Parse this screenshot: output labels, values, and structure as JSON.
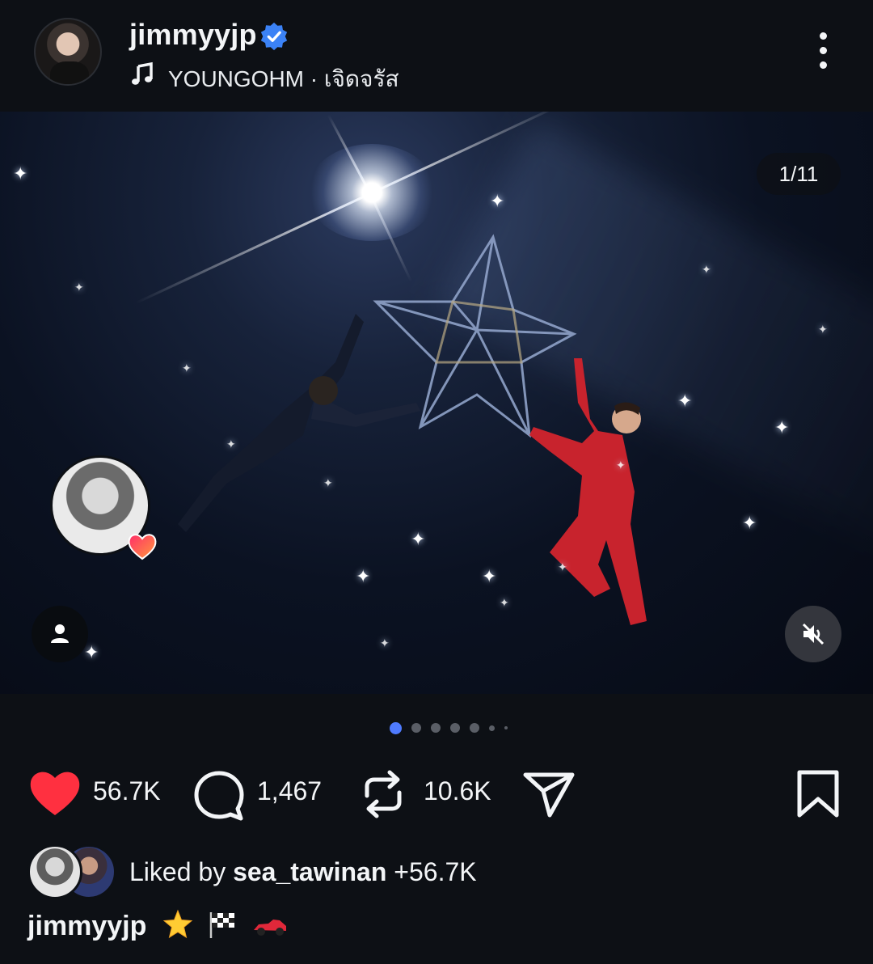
{
  "post": {
    "username": "jimmyyjp",
    "verified": true,
    "song": "YOUNGOHM · เจิดจรัส",
    "media_counter": "1/11",
    "carousel": {
      "current": 1,
      "visible_dots": 7
    }
  },
  "actions": {
    "likes": "56.7K",
    "comments": "1,467",
    "reposts": "10.6K"
  },
  "liked_by": {
    "prefix": "Liked by ",
    "user": "sea_tawinan",
    "suffix": " +56.7K"
  },
  "caption": {
    "username": "jimmyyjp",
    "emojis": [
      "star",
      "checkered-flag",
      "race-car"
    ]
  },
  "colors": {
    "background": "#0d1015",
    "verified": "#3b82f6",
    "like": "#ff3040",
    "active_dot": "#4f7bff"
  },
  "icons": [
    "verified-icon",
    "music-note-icon",
    "more-icon",
    "user-tag-icon",
    "mute-icon",
    "heart-icon",
    "comment-icon",
    "repost-icon",
    "share-icon",
    "bookmark-icon"
  ]
}
